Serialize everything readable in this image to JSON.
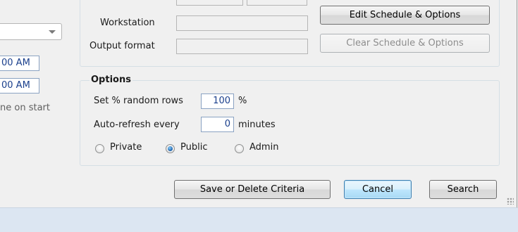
{
  "labels": {
    "workstation": "Workstation",
    "output_format": "Output format"
  },
  "buttons": {
    "edit_schedule": "Edit Schedule & Options",
    "clear_schedule": "Clear Schedule & Options",
    "save_delete": "Save or Delete Criteria",
    "cancel": "Cancel",
    "search": "Search"
  },
  "left_panel": {
    "time_1": "00 AM",
    "time_2": "00 AM",
    "on_start_text": "ne on start"
  },
  "options": {
    "title": "Options",
    "random_rows_label": "Set % random rows",
    "random_rows_value": "100",
    "random_rows_unit": "%",
    "refresh_label": "Auto-refresh every",
    "refresh_value": "0",
    "refresh_unit": "minutes",
    "visibility": [
      {
        "label": "Private",
        "checked": false
      },
      {
        "label": "Public",
        "checked": true
      },
      {
        "label": "Admin",
        "checked": false
      }
    ]
  }
}
